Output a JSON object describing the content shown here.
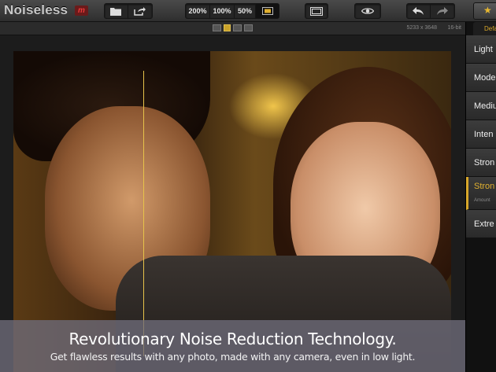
{
  "app": {
    "title": "Noiseless"
  },
  "toolbar": {
    "zoom_200": "200%",
    "zoom_100": "100%",
    "zoom_50": "50%"
  },
  "infobar": {
    "dimensions": "5233 x 3648",
    "bit_depth": "16-bit"
  },
  "panel": {
    "tab_label": "Defa",
    "presets": [
      {
        "label": "Light"
      },
      {
        "label": "Mode"
      },
      {
        "label": "Mediu"
      },
      {
        "label": "Inten"
      },
      {
        "label": "Stron"
      },
      {
        "label": "Stron",
        "active": true,
        "sub": "Amount"
      },
      {
        "label": "Extre"
      }
    ]
  },
  "caption": {
    "title": "Revolutionary Noise Reduction Technology.",
    "subtitle": "Get flawless results with any photo, made with any camera, even in low light."
  },
  "colors": {
    "accent": "#d8a72a",
    "split_line": "#e6c24a",
    "logo_red": "#e83a3a"
  }
}
